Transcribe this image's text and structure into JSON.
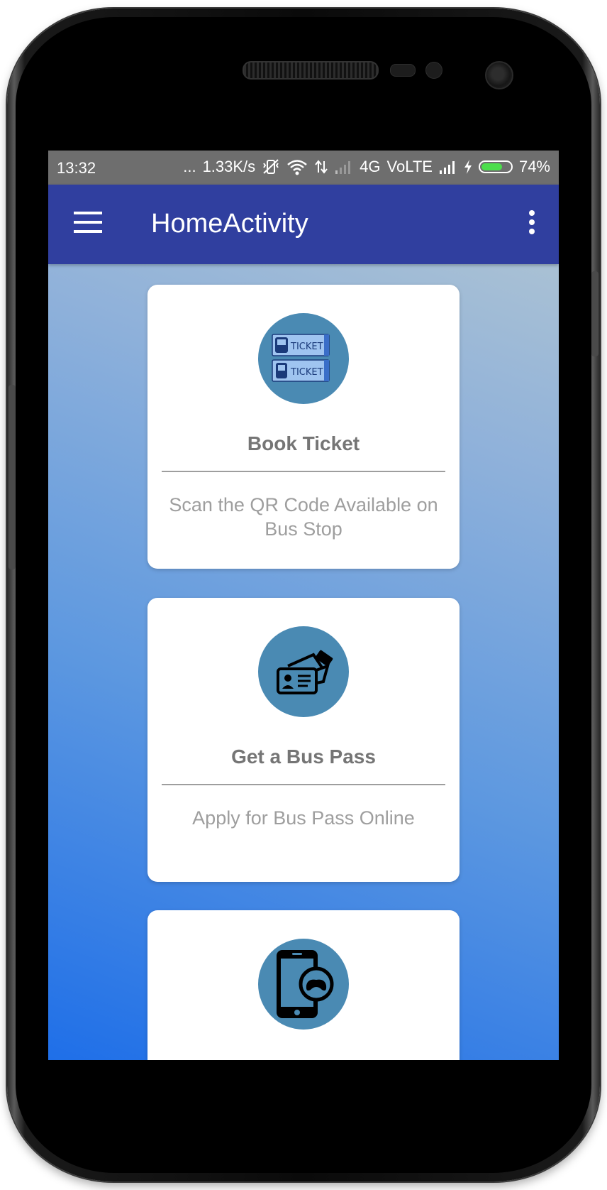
{
  "status_bar": {
    "time": "13:32",
    "dots": "...",
    "network_speed": "1.33K/s",
    "network_type": "4G",
    "volte": "VoLTE",
    "battery_percent": "74%",
    "battery_level": 0.74
  },
  "app_bar": {
    "title": "HomeActivity",
    "menu_icon": "hamburger-menu-icon",
    "overflow_icon": "more-vert-icon",
    "color": "#303f9f"
  },
  "cards": [
    {
      "icon": "bus-train-ticket-icon",
      "title": "Book Ticket",
      "description": "Scan the QR Code Available on Bus Stop"
    },
    {
      "icon": "id-card-pass-icon",
      "title": "Get a Bus Pass",
      "description": "Apply for Bus Pass Online"
    },
    {
      "icon": "phone-game-icon",
      "title": "",
      "description": ""
    }
  ]
}
